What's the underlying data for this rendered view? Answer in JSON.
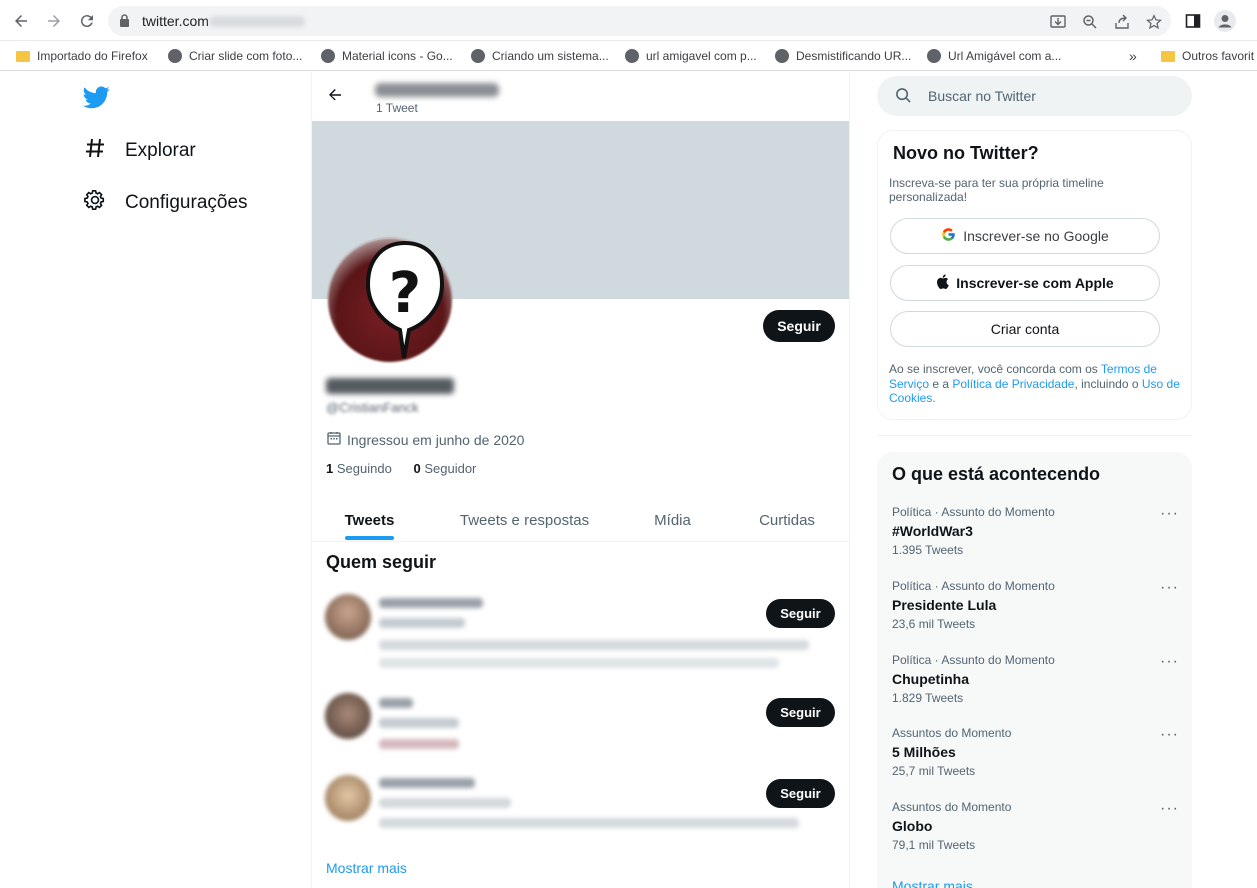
{
  "browser": {
    "url": "twitter.com",
    "bookmarks": [
      {
        "label": "Importado do Firefox",
        "icon": "folder-icon"
      },
      {
        "label": "Criar slide com foto...",
        "icon": "globe-icon"
      },
      {
        "label": "Material icons - Go...",
        "icon": "globe-icon"
      },
      {
        "label": "Criando um sistema...",
        "icon": "globe-icon"
      },
      {
        "label": "url amigavel com p...",
        "icon": "globe-icon"
      },
      {
        "label": "Desmistificando UR...",
        "icon": "globe-icon"
      },
      {
        "label": "Url Amigável com a...",
        "icon": "globe-icon"
      }
    ],
    "bookmarks_overflow": "»",
    "other_favorites": "Outros favorit"
  },
  "left_nav": {
    "items": [
      {
        "label": "Explorar",
        "icon": "hashtag-icon"
      },
      {
        "label": "Configurações",
        "icon": "gear-icon"
      }
    ]
  },
  "profile": {
    "tweet_count": "1 Tweet",
    "follow_label": "Seguir",
    "handle": "@CristianFanck",
    "joined": "Ingressou em junho de 2020",
    "following_count": "1",
    "following_label": "Seguindo",
    "followers_count": "0",
    "followers_label": "Seguidor",
    "tabs": [
      "Tweets",
      "Tweets e respostas",
      "Mídia",
      "Curtidas"
    ]
  },
  "who_to_follow": {
    "title": "Quem seguir",
    "follow_label": "Seguir",
    "more_label": "Mostrar mais"
  },
  "search": {
    "placeholder": "Buscar no Twitter"
  },
  "signup": {
    "title": "Novo no Twitter?",
    "subtitle": "Inscreva-se para ter sua própria timeline personalizada!",
    "google": "Inscrever-se no Google",
    "apple": "Inscrever-se com Apple",
    "create": "Criar conta",
    "terms_1": "Ao se inscrever, você concorda com os ",
    "terms_link1": "Termos de Serviço",
    "terms_2": " e a ",
    "terms_link2": "Política de Privacidade",
    "terms_3": ", incluindo o ",
    "terms_link3": "Uso de Cookies",
    "terms_4": "."
  },
  "trends": {
    "title": "O que está acontecendo",
    "items": [
      {
        "context": "Política · Assunto do Momento",
        "name": "#WorldWar3",
        "count": "1.395 Tweets"
      },
      {
        "context": "Política · Assunto do Momento",
        "name": "Presidente Lula",
        "count": "23,6 mil Tweets"
      },
      {
        "context": "Política · Assunto do Momento",
        "name": "Chupetinha",
        "count": "1.829 Tweets"
      },
      {
        "context": "Assuntos do Momento",
        "name": "5 Milhões",
        "count": "25,7 mil Tweets"
      },
      {
        "context": "Assuntos do Momento",
        "name": "Globo",
        "count": "79,1 mil Tweets"
      }
    ],
    "more_label": "Mostrar mais"
  },
  "colors": {
    "accent": "#1d9bf0",
    "banner": "#cfd9de",
    "dark": "#0f1419",
    "muted": "#536471"
  }
}
